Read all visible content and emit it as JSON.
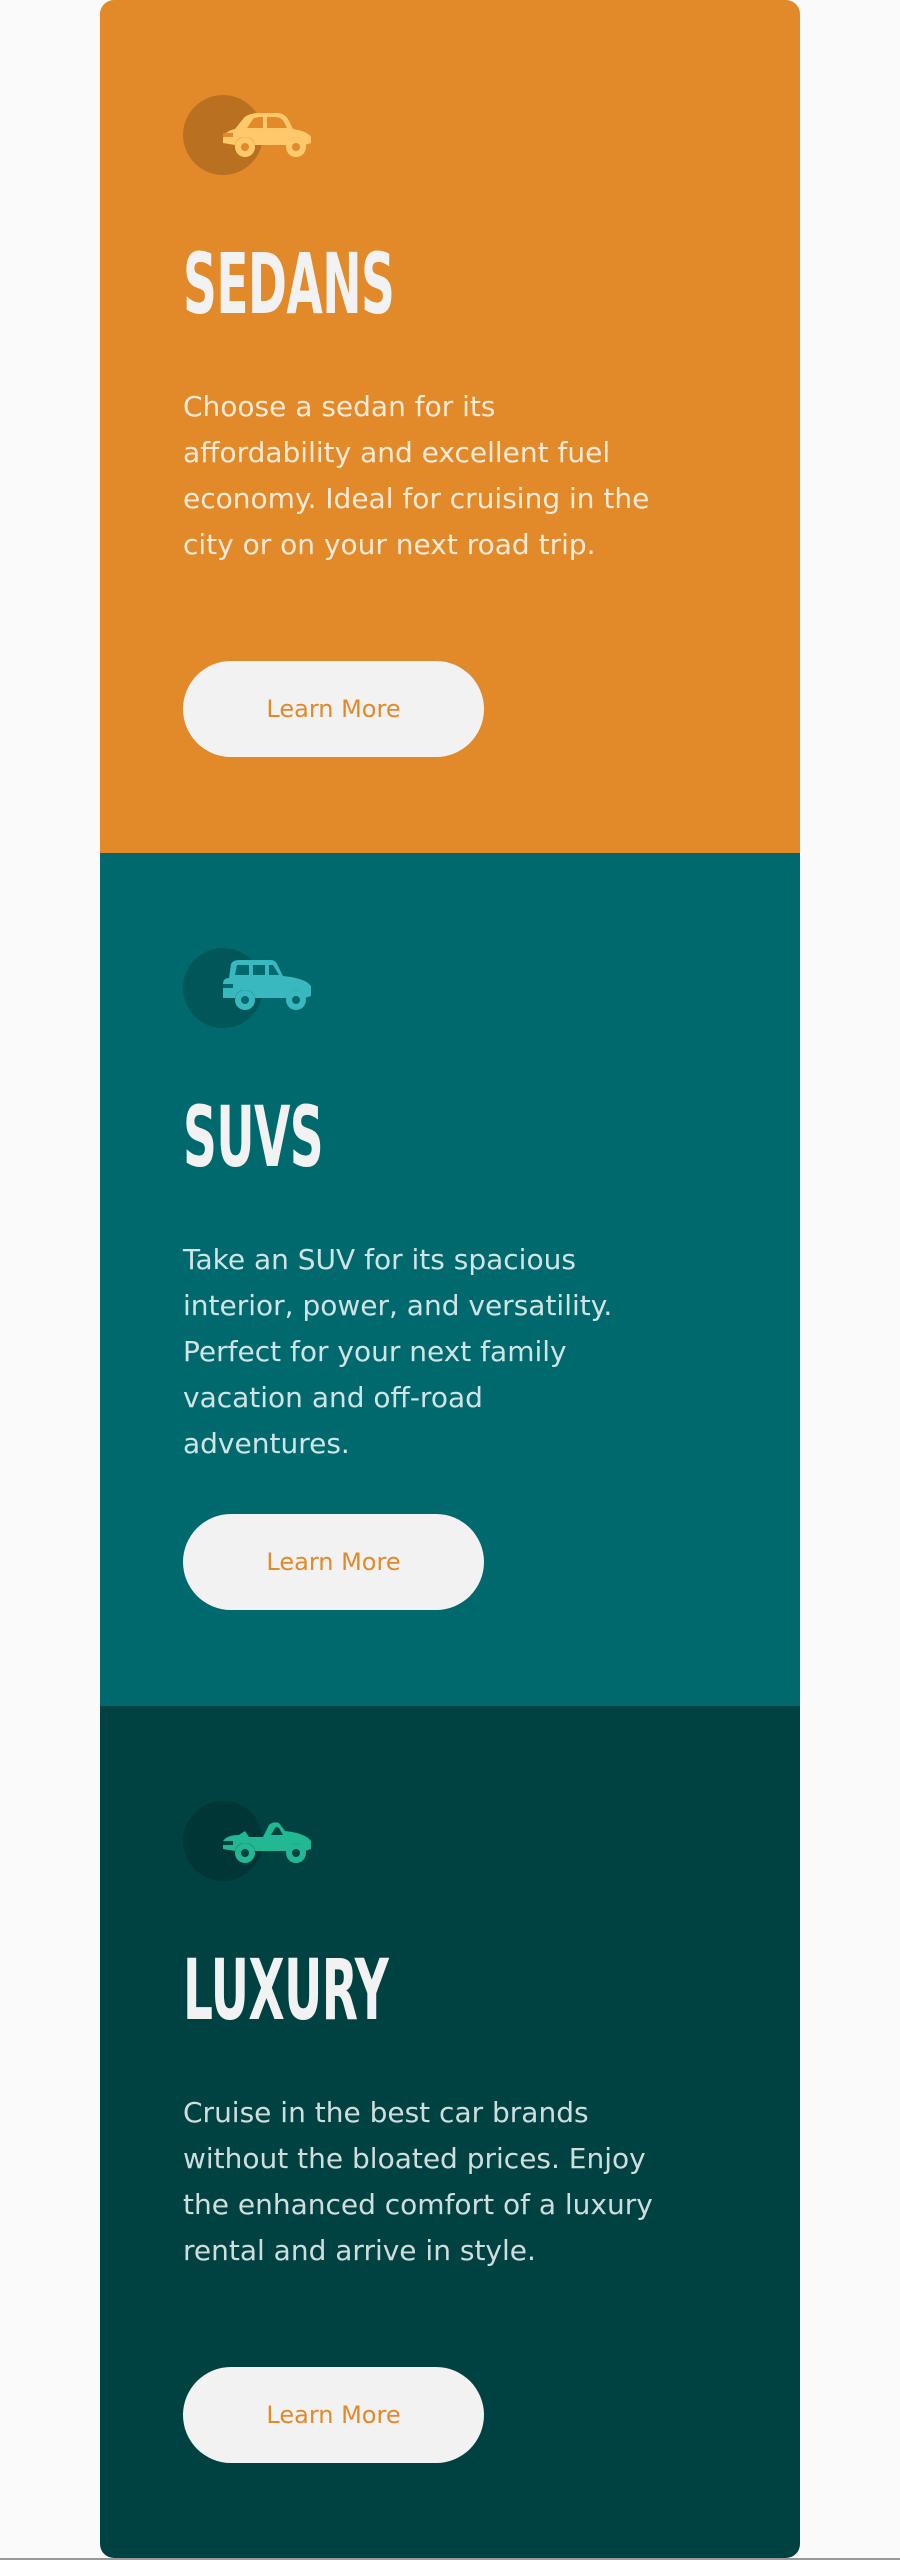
{
  "colors": {
    "page_background": "#fafafa",
    "sedans": "#e28929",
    "suvs": "#00696d",
    "luxury": "#004242",
    "button_background": "#f2f2f2",
    "heading": "#f2f2f2"
  },
  "cards": [
    {
      "icon": "sedan-car-icon",
      "title": "SEDANS",
      "description": "Choose a sedan for its affordability and excellent fuel economy. Ideal for cruising in the city or on your next road trip.",
      "button_label": "Learn More",
      "background": "#e28929",
      "button_text_color": "#e28929"
    },
    {
      "icon": "suv-car-icon",
      "title": "SUVS",
      "description": "Take an SUV for its spacious interior, power, and versatility. Perfect for your next family vacation and off-road adventures.",
      "button_label": "Learn More",
      "background": "#00696d",
      "button_text_color": "#e28929"
    },
    {
      "icon": "luxury-car-icon",
      "title": "LUXURY",
      "description": "Cruise in the best car brands without the bloated prices. Enjoy the enhanced comfort of a luxury rental and arrive in style.",
      "button_label": "Learn More",
      "background": "#004242",
      "button_text_color": "#e28929"
    }
  ]
}
